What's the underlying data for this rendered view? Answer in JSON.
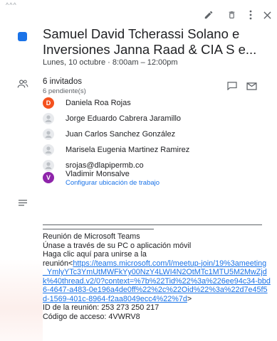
{
  "topbar": {
    "corner": "^^^",
    "icons": [
      "edit-icon",
      "delete-icon",
      "more-vert-icon",
      "close-icon"
    ]
  },
  "event": {
    "title_line1": "Samuel David Tcherassi Solano e",
    "title_line2": "Inversiones Janna Raad & CIA S e...",
    "datetime": "Lunes, 10 octubre  ·  8:00am – 12:00pm",
    "color": "#1a73e8"
  },
  "guests": {
    "count": "6 invitados",
    "pending": "6 pendiente(s)",
    "list": [
      {
        "initial": "D",
        "name": "Daniela Roa Rojas",
        "color": "#f4511e"
      },
      {
        "initial": "",
        "name": "Jorge Eduardo Cabrera Jaramillo",
        "color": "#e8eaed"
      },
      {
        "initial": "",
        "name": "Juan Carlos Sanchez González",
        "color": "#e8eaed"
      },
      {
        "initial": "",
        "name": "Marisela Eugenia Martinez Ramirez",
        "color": "#e8eaed"
      },
      {
        "initial": "",
        "name": "srojas@dlapipermb.co",
        "color": "#e8eaed"
      },
      {
        "initial": "V",
        "name": "Vladimir Monsalve",
        "color": "#8e24aa"
      }
    ],
    "work_location_link": "Configurar ubicación de trabajo"
  },
  "description": {
    "heading": "Reunión de Microsoft Teams",
    "line2": "Únase a través de su PC o aplicación móvil",
    "line3": "Haga clic aquí para unirse a la",
    "line4_prefix": "reunión<",
    "link": "https://teams.microsoft.com/l/meetup-join/19%3ameeting_YmlyYTc3YmUtMWFkYy00NzY4LWI4N2OtMTc1MTU5M2MwZjdk%40thread.v2/0?context=%7b%22Tid%22%3a%226ee94c34-bbd6-4647-a483-0e196a4de0ff%22%2c%22Oid%22%3a%22d7e45f5d-1569-401c-8964-f2aa8049ecc4%22%7d",
    "link_suffix": ">",
    "meeting_id": "ID de la reunión: 253 273 250 217",
    "access_code": "Código de acceso: 4VWRV8"
  }
}
